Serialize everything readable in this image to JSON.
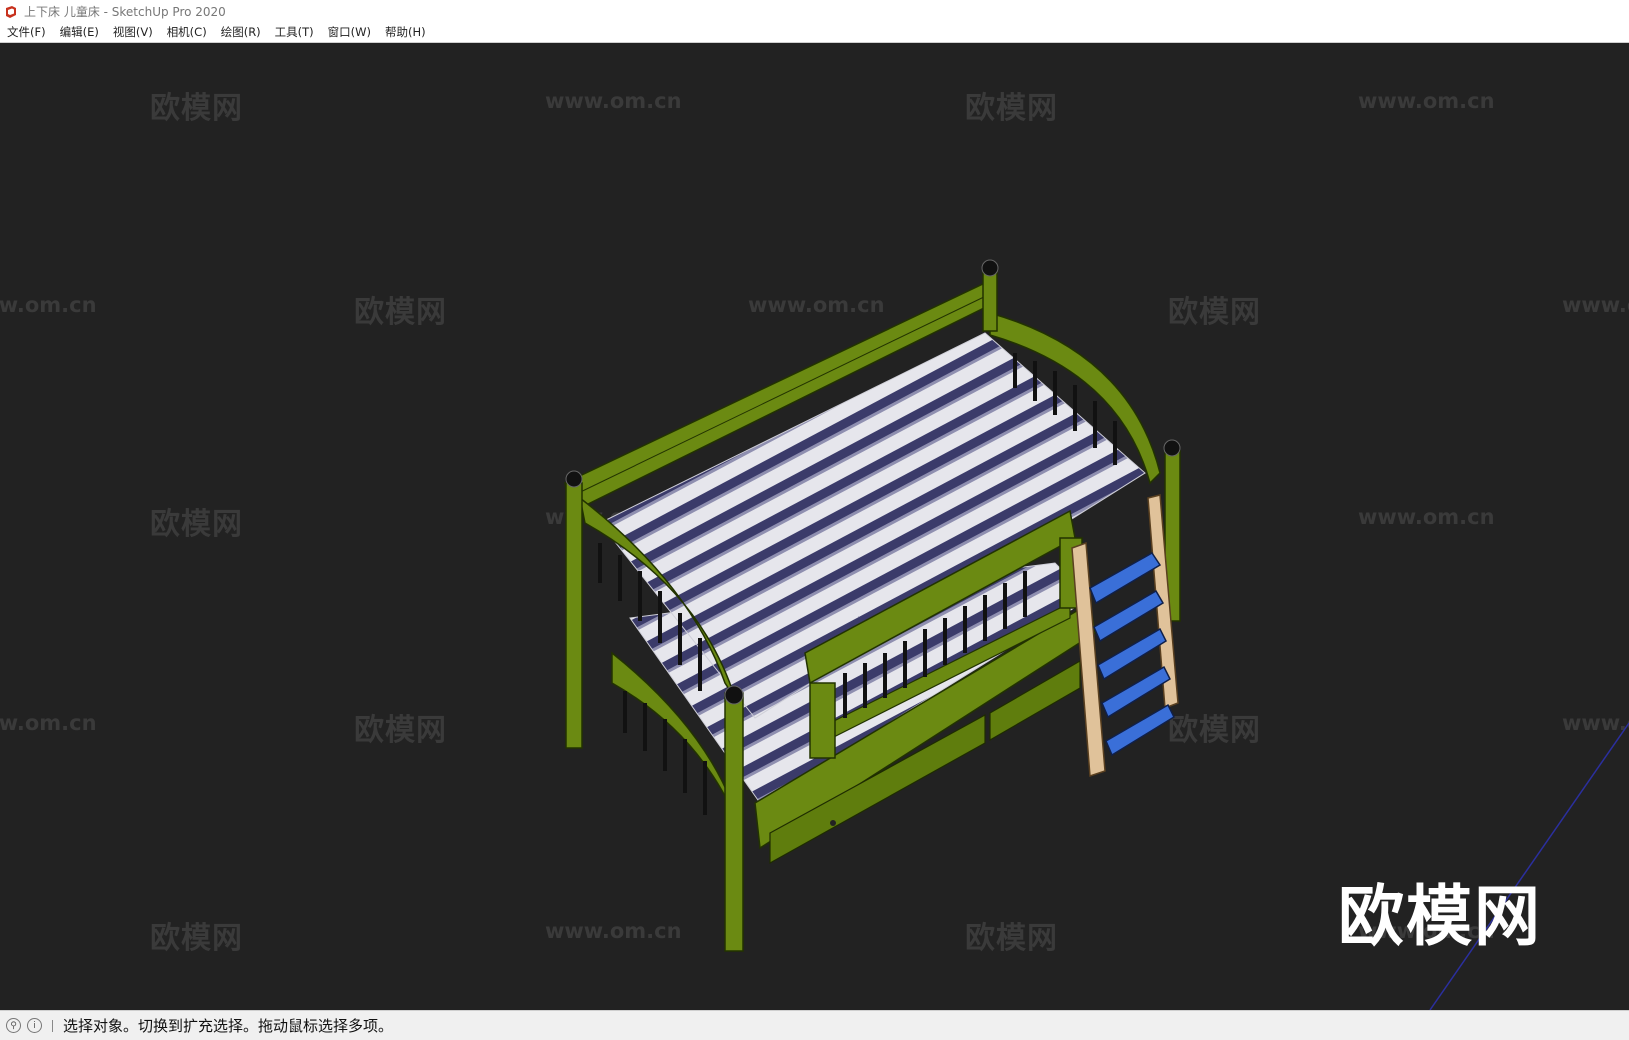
{
  "window": {
    "title": "上下床 儿童床 - SketchUp Pro 2020",
    "app_icon": "sketchup-icon",
    "accent_color": "#c8321e"
  },
  "menubar": {
    "items": [
      {
        "label": "文件(F)"
      },
      {
        "label": "编辑(E)"
      },
      {
        "label": "视图(V)"
      },
      {
        "label": "相机(C)"
      },
      {
        "label": "绘图(R)"
      },
      {
        "label": "工具(T)"
      },
      {
        "label": "窗口(W)"
      },
      {
        "label": "帮助(H)"
      }
    ]
  },
  "viewport": {
    "background": "#222222",
    "model_colors": {
      "frame": "#6b8a12",
      "mattress_light": "#e8e8ee",
      "mattress_stripe": "#3b3b6a",
      "ladder_rail": "#e0c29a",
      "ladder_step": "#3a6fd8"
    },
    "watermark_cn": "欧模网",
    "watermark_url": "www.om.cn",
    "watermark_large": "欧模网"
  },
  "statusbar": {
    "geo_icon": "location-pin-icon",
    "info_icon": "info-icon",
    "message": "选择对象。切换到扩充选择。拖动鼠标选择多项。"
  }
}
